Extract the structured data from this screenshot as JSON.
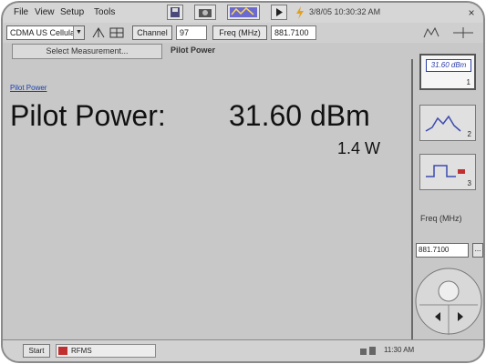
{
  "menu": {
    "items": [
      "File",
      "View",
      "Setup",
      "Tools"
    ],
    "clock_text": "3/8/05 10:30:32 AM",
    "play_icon": "play-icon"
  },
  "controls": {
    "standard_select": "CDMA US Cellular",
    "channel_button": "Channel",
    "channel_value": "97",
    "freq_button": "Freq (MHz)",
    "freq_value": "881.7100"
  },
  "tabs": {
    "select_measurement": "Select Measurement...",
    "active_tab": "Pilot Power"
  },
  "main": {
    "link_text": "Pilot Power",
    "label": "Pilot Power:",
    "value": "31.60 dBm",
    "watts": "1.4 W"
  },
  "right_panel": {
    "view_readout": "31.60 dBm",
    "view_numbers": [
      "1",
      "2",
      "3"
    ],
    "freq_label": "Freq (MHz)",
    "freq_input": "881.7100",
    "freq_button": "..."
  },
  "taskbar": {
    "start_label": "Start",
    "task_label": "RFMS",
    "tray_time": "11:30 AM"
  },
  "colors": {
    "frame_bg": "#c8c8c8",
    "link": "#1a3fb0",
    "readout": "#2a3da8"
  }
}
